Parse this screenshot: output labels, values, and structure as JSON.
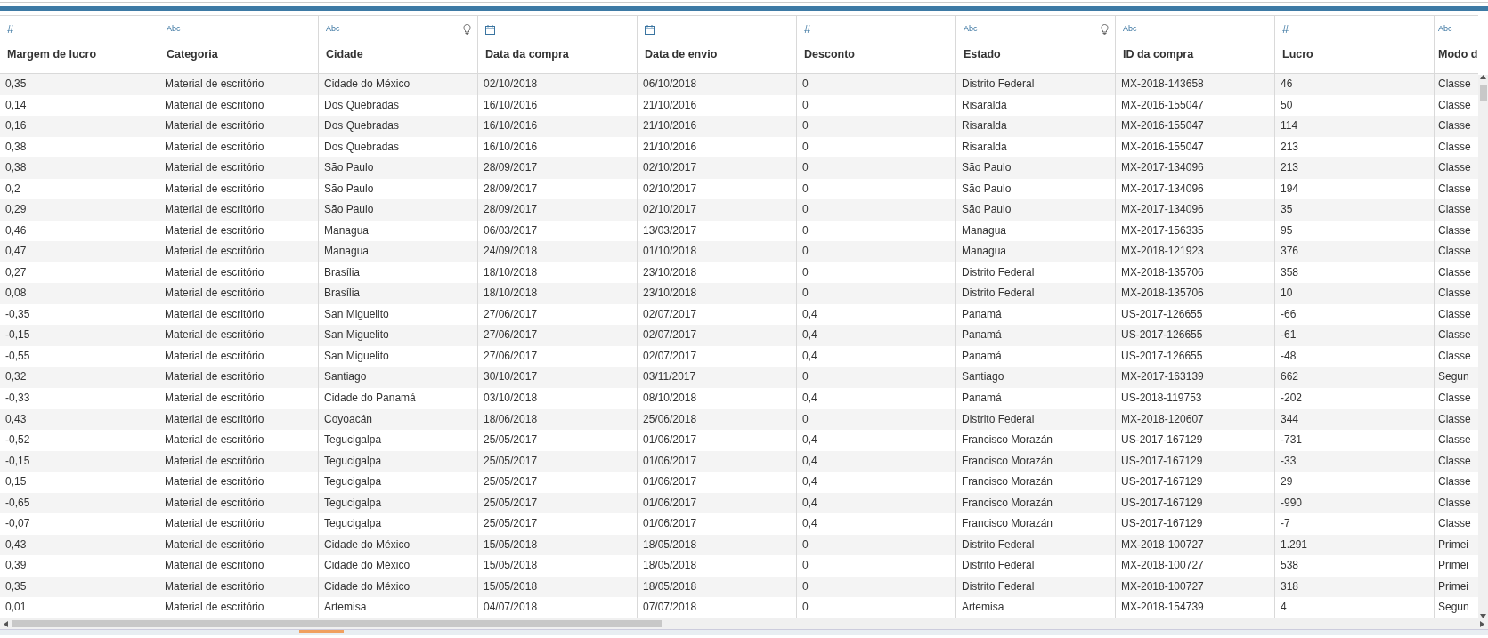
{
  "columns": [
    {
      "label": "Margem de lucro",
      "kind": "number",
      "type_label": "#",
      "geo": false
    },
    {
      "label": "Categoria",
      "kind": "string",
      "type_label": "Abc",
      "geo": false
    },
    {
      "label": "Cidade",
      "kind": "string",
      "type_label": "Abc",
      "geo": true
    },
    {
      "label": "Data da compra",
      "kind": "date",
      "geo": false
    },
    {
      "label": "Data de envio",
      "kind": "date",
      "geo": false
    },
    {
      "label": "Desconto",
      "kind": "number",
      "type_label": "#",
      "geo": false
    },
    {
      "label": "Estado",
      "kind": "string",
      "type_label": "Abc",
      "geo": true
    },
    {
      "label": "ID da compra",
      "kind": "string",
      "type_label": "Abc",
      "geo": false
    },
    {
      "label": "Lucro",
      "kind": "number",
      "type_label": "#",
      "geo": false
    },
    {
      "label": "Modo d",
      "kind": "string",
      "type_label": "Abc",
      "geo": false
    }
  ],
  "rows": [
    [
      "0,35",
      "Material de escritório",
      "Cidade do México",
      "02/10/2018",
      "06/10/2018",
      "0",
      "Distrito Federal",
      "MX-2018-143658",
      "46",
      "Classe"
    ],
    [
      "0,14",
      "Material de escritório",
      "Dos Quebradas",
      "16/10/2016",
      "21/10/2016",
      "0",
      "Risaralda",
      "MX-2016-155047",
      "50",
      "Classe"
    ],
    [
      "0,16",
      "Material de escritório",
      "Dos Quebradas",
      "16/10/2016",
      "21/10/2016",
      "0",
      "Risaralda",
      "MX-2016-155047",
      "114",
      "Classe"
    ],
    [
      "0,38",
      "Material de escritório",
      "Dos Quebradas",
      "16/10/2016",
      "21/10/2016",
      "0",
      "Risaralda",
      "MX-2016-155047",
      "213",
      "Classe"
    ],
    [
      "0,38",
      "Material de escritório",
      "São Paulo",
      "28/09/2017",
      "02/10/2017",
      "0",
      "São Paulo",
      "MX-2017-134096",
      "213",
      "Classe"
    ],
    [
      "0,2",
      "Material de escritório",
      "São Paulo",
      "28/09/2017",
      "02/10/2017",
      "0",
      "São Paulo",
      "MX-2017-134096",
      "194",
      "Classe"
    ],
    [
      "0,29",
      "Material de escritório",
      "São Paulo",
      "28/09/2017",
      "02/10/2017",
      "0",
      "São Paulo",
      "MX-2017-134096",
      "35",
      "Classe"
    ],
    [
      "0,46",
      "Material de escritório",
      "Managua",
      "06/03/2017",
      "13/03/2017",
      "0",
      "Managua",
      "MX-2017-156335",
      "95",
      "Classe"
    ],
    [
      "0,47",
      "Material de escritório",
      "Managua",
      "24/09/2018",
      "01/10/2018",
      "0",
      "Managua",
      "MX-2018-121923",
      "376",
      "Classe"
    ],
    [
      "0,27",
      "Material de escritório",
      "Brasília",
      "18/10/2018",
      "23/10/2018",
      "0",
      "Distrito Federal",
      "MX-2018-135706",
      "358",
      "Classe"
    ],
    [
      "0,08",
      "Material de escritório",
      "Brasília",
      "18/10/2018",
      "23/10/2018",
      "0",
      "Distrito Federal",
      "MX-2018-135706",
      "10",
      "Classe"
    ],
    [
      "-0,35",
      "Material de escritório",
      "San Miguelito",
      "27/06/2017",
      "02/07/2017",
      "0,4",
      "Panamá",
      "US-2017-126655",
      "-66",
      "Classe"
    ],
    [
      "-0,15",
      "Material de escritório",
      "San Miguelito",
      "27/06/2017",
      "02/07/2017",
      "0,4",
      "Panamá",
      "US-2017-126655",
      "-61",
      "Classe"
    ],
    [
      "-0,55",
      "Material de escritório",
      "San Miguelito",
      "27/06/2017",
      "02/07/2017",
      "0,4",
      "Panamá",
      "US-2017-126655",
      "-48",
      "Classe"
    ],
    [
      "0,32",
      "Material de escritório",
      "Santiago",
      "30/10/2017",
      "03/11/2017",
      "0",
      "Santiago",
      "MX-2017-163139",
      "662",
      "Segun"
    ],
    [
      "-0,33",
      "Material de escritório",
      "Cidade do Panamá",
      "03/10/2018",
      "08/10/2018",
      "0,4",
      "Panamá",
      "US-2018-119753",
      "-202",
      "Classe"
    ],
    [
      "0,43",
      "Material de escritório",
      "Coyoacán",
      "18/06/2018",
      "25/06/2018",
      "0",
      "Distrito Federal",
      "MX-2018-120607",
      "344",
      "Classe"
    ],
    [
      "-0,52",
      "Material de escritório",
      "Tegucigalpa",
      "25/05/2017",
      "01/06/2017",
      "0,4",
      "Francisco Morazán",
      "US-2017-167129",
      "-731",
      "Classe"
    ],
    [
      "-0,15",
      "Material de escritório",
      "Tegucigalpa",
      "25/05/2017",
      "01/06/2017",
      "0,4",
      "Francisco Morazán",
      "US-2017-167129",
      "-33",
      "Classe"
    ],
    [
      "0,15",
      "Material de escritório",
      "Tegucigalpa",
      "25/05/2017",
      "01/06/2017",
      "0,4",
      "Francisco Morazán",
      "US-2017-167129",
      "29",
      "Classe"
    ],
    [
      "-0,65",
      "Material de escritório",
      "Tegucigalpa",
      "25/05/2017",
      "01/06/2017",
      "0,4",
      "Francisco Morazán",
      "US-2017-167129",
      "-990",
      "Classe"
    ],
    [
      "-0,07",
      "Material de escritório",
      "Tegucigalpa",
      "25/05/2017",
      "01/06/2017",
      "0,4",
      "Francisco Morazán",
      "US-2017-167129",
      "-7",
      "Classe"
    ],
    [
      "0,43",
      "Material de escritório",
      "Cidade do México",
      "15/05/2018",
      "18/05/2018",
      "0",
      "Distrito Federal",
      "MX-2018-100727",
      "1.291",
      "Primei"
    ],
    [
      "0,39",
      "Material de escritório",
      "Cidade do México",
      "15/05/2018",
      "18/05/2018",
      "0",
      "Distrito Federal",
      "MX-2018-100727",
      "538",
      "Primei"
    ],
    [
      "0,35",
      "Material de escritório",
      "Cidade do México",
      "15/05/2018",
      "18/05/2018",
      "0",
      "Distrito Federal",
      "MX-2018-100727",
      "318",
      "Primei"
    ],
    [
      "0,01",
      "Material de escritório",
      "Artemisa",
      "04/07/2018",
      "07/07/2018",
      "0",
      "Artemisa",
      "MX-2018-154739",
      "4",
      "Segun"
    ]
  ]
}
